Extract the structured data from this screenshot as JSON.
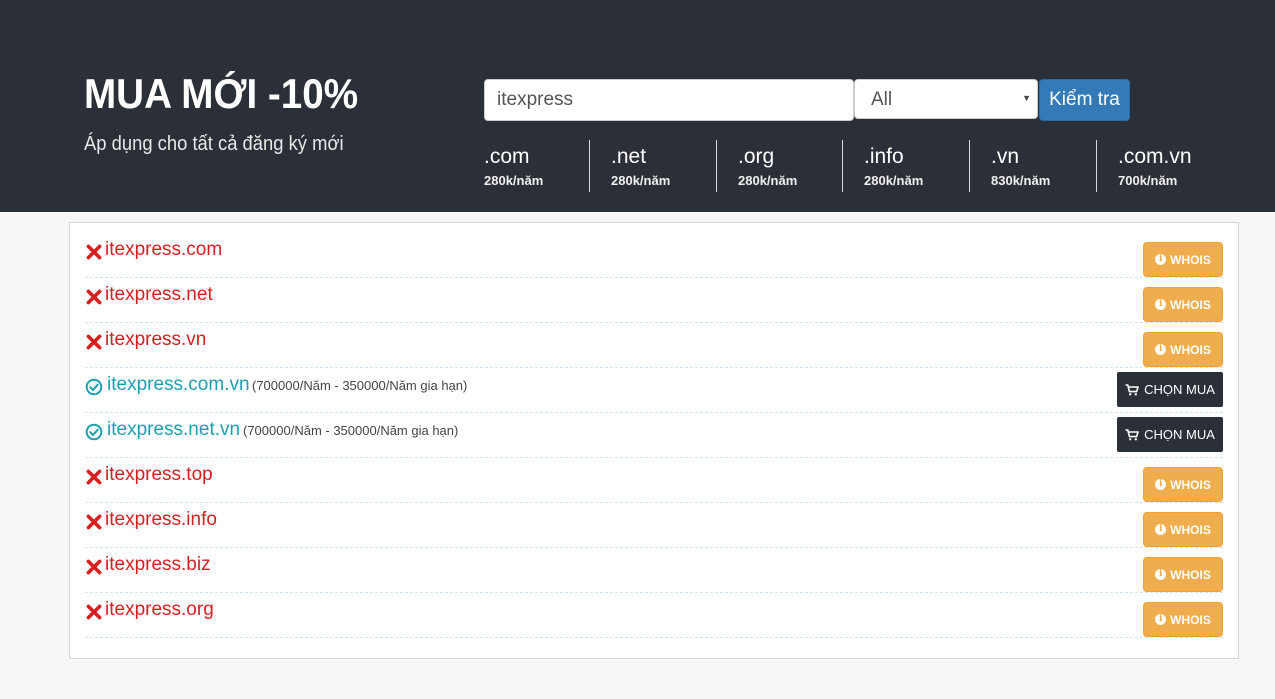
{
  "hero": {
    "title": "MUA MỚI -10%",
    "subtitle": "Áp dụng cho tất cả đăng ký mới"
  },
  "search": {
    "value": "itexpress",
    "select_value": "All",
    "button_label": "Kiểm tra"
  },
  "tlds": [
    {
      "name": ".com",
      "price": "280k/năm"
    },
    {
      "name": ".net",
      "price": "280k/năm"
    },
    {
      "name": ".org",
      "price": "280k/năm"
    },
    {
      "name": ".info",
      "price": "280k/năm"
    },
    {
      "name": ".vn",
      "price": "830k/năm"
    },
    {
      "name": ".com.vn",
      "price": "700k/năm"
    }
  ],
  "results": [
    {
      "domain": "itexpress.com",
      "status": "taken",
      "action": "WHOIS"
    },
    {
      "domain": "itexpress.net",
      "status": "taken",
      "action": "WHOIS"
    },
    {
      "domain": "itexpress.vn",
      "status": "taken",
      "action": "WHOIS"
    },
    {
      "domain": "itexpress.com.vn",
      "status": "available",
      "price": "(700000/Năm - 350000/Năm gia hạn)",
      "action": "CHỌN MUA"
    },
    {
      "domain": "itexpress.net.vn",
      "status": "available",
      "price": "(700000/Năm - 350000/Năm gia hạn)",
      "action": "CHỌN MUA"
    },
    {
      "domain": "itexpress.top",
      "status": "taken",
      "action": "WHOIS"
    },
    {
      "domain": "itexpress.info",
      "status": "taken",
      "action": "WHOIS"
    },
    {
      "domain": "itexpress.biz",
      "status": "taken",
      "action": "WHOIS"
    },
    {
      "domain": "itexpress.org",
      "status": "taken",
      "action": "WHOIS"
    }
  ],
  "icons": {
    "taken": "cross-icon",
    "available": "check-circle-icon",
    "whois": "info-icon",
    "buy": "cart-icon"
  },
  "colors": {
    "header_bg": "#2b2f38",
    "taken": "#d62020",
    "available": "#1d9fb0",
    "whois_btn": "#f0ad4e",
    "buy_btn": "#2b2f38",
    "check_btn": "#337ab7"
  }
}
